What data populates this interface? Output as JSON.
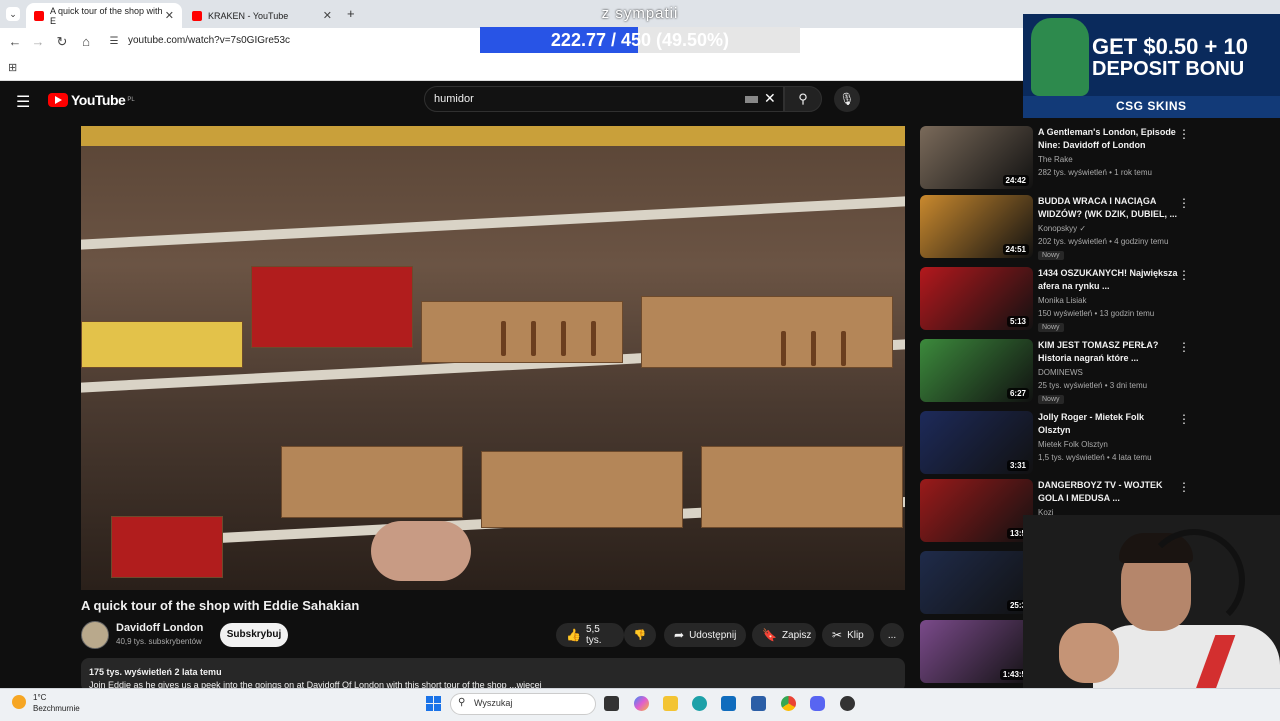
{
  "browser": {
    "tabs": [
      {
        "label": "A quick tour of the shop with E",
        "active": true
      },
      {
        "label": "KRAKEN - YouTube",
        "active": false
      }
    ],
    "new_tab": "+",
    "url": "youtube.com/watch?v=7s0GIGre53c"
  },
  "overlay": {
    "title": "z sympatii",
    "progress_text": "222.77 / 450 (49.50%)",
    "progress_fraction": 0.495,
    "fill_color": "#2854e6"
  },
  "youtube": {
    "logo": "YouTube",
    "region": "PL",
    "search_value": "humidor"
  },
  "video": {
    "title": "A quick tour of the shop with Eddie Sahakian",
    "channel": "Davidoff London",
    "subscribers": "40,9 tys. subskrybentów",
    "subscribe_label": "Subskrybuj",
    "likes": "5,5 tys.",
    "share_label": "Udostępnij",
    "save_label": "Zapisz",
    "clip_label": "Klip",
    "more_label": "...",
    "views_meta": "175 tys. wyświetleń  2 lata temu",
    "description": "Join Eddie as he gives us a peek into the goings on at Davidoff Of London with this short tour of the shop ...więcej"
  },
  "related": [
    {
      "title": "A Gentleman's London, Episode Nine: Davidoff of London",
      "channel": "The Rake",
      "meta": "282 tys. wyświetleń • 1 rok temu",
      "duration": "24:42",
      "badge": "",
      "color": "#7a6a5a"
    },
    {
      "title": "BUDDA WRACA I NACIĄGA WIDZÓW? (WK DZIK, DUBIEL, ...",
      "channel": "Konopskyy ✓",
      "meta": "202 tys. wyświetleń • 4 godziny temu",
      "duration": "24:51",
      "badge": "Nowy",
      "color": "#c9892e"
    },
    {
      "title": "1434 OSZUKANYCH! Największa afera na rynku ...",
      "channel": "Monika Lisiak",
      "meta": "150 wyświetleń • 13 godzin temu",
      "duration": "5:13",
      "badge": "Nowy",
      "color": "#b3181d"
    },
    {
      "title": "KIM JEST TOMASZ PERŁA? Historia nagrań które ...",
      "channel": "DOMINEWS",
      "meta": "25 tys. wyświetleń • 3 dni temu",
      "duration": "6:27",
      "badge": "Nowy",
      "color": "#3c8a3c"
    },
    {
      "title": "Jolly Roger - Mietek Folk Olsztyn",
      "channel": "Mietek Folk Olsztyn",
      "meta": "1,5 tys. wyświetleń • 4 lata temu",
      "duration": "3:31",
      "badge": "",
      "color": "#1d2a5a"
    },
    {
      "title": "DANGERBOYZ TV - WOJTEK GOLA I MEDUSA ...",
      "channel": "Kozi",
      "meta": "",
      "duration": "13:5",
      "badge": "",
      "color": "#9a1a1a"
    },
    {
      "title": "",
      "channel": "",
      "meta": "",
      "duration": "25:3",
      "badge": "",
      "color": "#1f2b4a"
    },
    {
      "title": "",
      "channel": "",
      "meta": "",
      "duration": "1:43:5",
      "badge": "",
      "color": "#7a4a8a"
    }
  ],
  "ad": {
    "line1": "GET $0.50 + 10",
    "line2": "DEPOSIT BONU",
    "brand": "CSG SKINS"
  },
  "taskbar": {
    "temp": "1°C",
    "weather": "Bezchmurnie",
    "search_placeholder": "Wyszukaj"
  }
}
